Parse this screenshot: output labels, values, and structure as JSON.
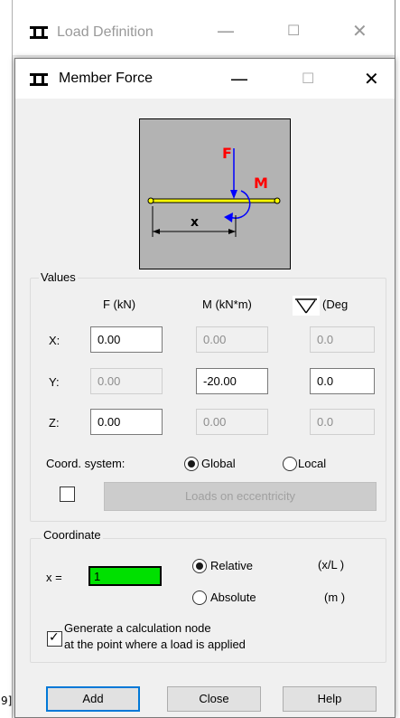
{
  "background_window": {
    "title": "Load Definition",
    "minimize": "—",
    "maximize": "☐",
    "close": "✕",
    "edge_text": "9]"
  },
  "dialog": {
    "title": "Member Force",
    "minimize": "—",
    "maximize": "☐",
    "close": "✕"
  },
  "diagram": {
    "force_label": "F",
    "moment_label": "M",
    "position_label": "x",
    "force_color": "#ff0000",
    "moment_color": "#0000ff",
    "beam_color": "#ffff00",
    "background_color": "#b3b3b3"
  },
  "values": {
    "legend": "Values",
    "col_force": "F  (kN)",
    "col_moment": "M  (kN*m)",
    "col_angle": "(Deg",
    "rows": [
      {
        "label": "X:",
        "force": "0.00",
        "moment": "0.00",
        "angle": "0.0"
      },
      {
        "label": "Y:",
        "force": "0.00",
        "moment": "-20.00",
        "angle": "0.0"
      },
      {
        "label": "Z:",
        "force": "0.00",
        "moment": "0.00",
        "angle": "0.0"
      }
    ],
    "coord_system_label": "Coord. system:",
    "global_label": "Global",
    "local_label": "Local",
    "coord_system_selected": "Global",
    "eccentricity_checked": false,
    "eccentricity_button": "Loads on eccentricity"
  },
  "coordinate": {
    "legend": "Coordinate",
    "x_label": "x =",
    "x_value": "1",
    "relative_label": "Relative",
    "absolute_label": "Absolute",
    "selected": "Relative",
    "relative_unit": "(x/L )",
    "absolute_unit": "(m )",
    "input_color": "#00e000"
  },
  "generate_node": {
    "checked": true,
    "check_mark": "✓",
    "line1": "Generate a calculation node",
    "line2": "at the point where a load is applied"
  },
  "buttons": {
    "add": "Add",
    "close": "Close",
    "help": "Help"
  }
}
